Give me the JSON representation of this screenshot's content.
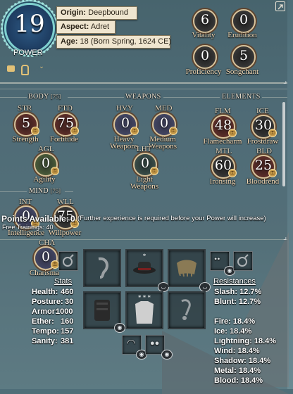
{
  "power": {
    "value": "19",
    "label": "POWER"
  },
  "profile": {
    "origin_key": "Origin:",
    "origin": "Deepbound",
    "aspect_key": "Aspect:",
    "aspect": "Adret",
    "age_key": "Age:",
    "age": "18 (Born Spring, 1624 CE)"
  },
  "top_stats": [
    {
      "name": "Vitality",
      "value": "6"
    },
    {
      "name": "Erudition",
      "value": "0"
    },
    {
      "name": "Proficiency",
      "value": "0"
    },
    {
      "name": "Songchant",
      "value": "5"
    }
  ],
  "sections": {
    "body": "BODY",
    "body_cap": "[75]",
    "weapons": "WEAPONS",
    "elements": "ELEMENTS",
    "mind": "MIND",
    "mind_cap": "[75]"
  },
  "attributes": {
    "str": {
      "abbr": "STR",
      "name": "Strength",
      "value": "5"
    },
    "ftd": {
      "abbr": "FTD",
      "name": "Fortitude",
      "value": "75"
    },
    "agl": {
      "abbr": "AGL",
      "name": "Agility",
      "value": "0"
    },
    "hvy": {
      "abbr": "HVY",
      "name": "Heavy Weapons",
      "value": "0"
    },
    "med": {
      "abbr": "MED",
      "name": "Medium Weapons",
      "value": "0"
    },
    "lht": {
      "abbr": "LHT",
      "name": "Light Weapons",
      "value": "0"
    },
    "flm": {
      "abbr": "FLM",
      "name": "Flamecharm",
      "value": "48"
    },
    "ice": {
      "abbr": "ICE",
      "name": "Frostdraw",
      "value": "30"
    },
    "mtl": {
      "abbr": "MTL",
      "name": "Ironsing",
      "value": "60"
    },
    "bld": {
      "abbr": "BLD",
      "name": "Bloodrend",
      "value": "25"
    },
    "int": {
      "abbr": "INT",
      "name": "Intelligence",
      "value": "0"
    },
    "wll": {
      "abbr": "WLL",
      "name": "Willpower",
      "value": "75"
    },
    "cha": {
      "abbr": "CHA",
      "name": "Charisma",
      "value": "0"
    }
  },
  "points": {
    "label": "Points Available:",
    "value": "0",
    "note": "(Further experience is required before your Power will increase)",
    "trainings": "Free Trainings: 40"
  },
  "stats": {
    "header": "Stats",
    "rows": [
      {
        "label": "Health:",
        "value": "460"
      },
      {
        "label": "Posture:",
        "value": "30"
      },
      {
        "label": "Armor:",
        "value": "1000"
      },
      {
        "label": "Ether:",
        "value": "160"
      },
      {
        "label": "Tempo:",
        "value": "157"
      },
      {
        "label": "Sanity:",
        "value": "381"
      }
    ]
  },
  "resistances": {
    "header": "Resistances",
    "rows": [
      {
        "label": "Slash:",
        "value": "12.7%"
      },
      {
        "label": "Blunt:",
        "value": "12.7%"
      },
      {
        "label": "Fire:",
        "value": "18.4%"
      },
      {
        "label": "Ice:",
        "value": "18.4%"
      },
      {
        "label": "Lightning:",
        "value": "18.4%"
      },
      {
        "label": "Wind:",
        "value": "18.4%"
      },
      {
        "label": "Shadow:",
        "value": "18.4%"
      },
      {
        "label": "Metal:",
        "value": "18.4%"
      },
      {
        "label": "Blood:",
        "value": "18.4%"
      }
    ]
  },
  "icons": {
    "corner": "external-link-icon",
    "talents": [
      "talent-icon",
      "key-icon",
      "wings-icon"
    ],
    "equip": [
      "ear-icon",
      "hat-icon",
      "cloak-icon",
      "chest-icon",
      "shirt-icon",
      "amulet-icon",
      "ring-icon",
      "face-icon"
    ]
  },
  "colors": {
    "accent": "#7fd0cf",
    "info_box": "#efe5cf",
    "stat_label": "#f3d9b5"
  }
}
